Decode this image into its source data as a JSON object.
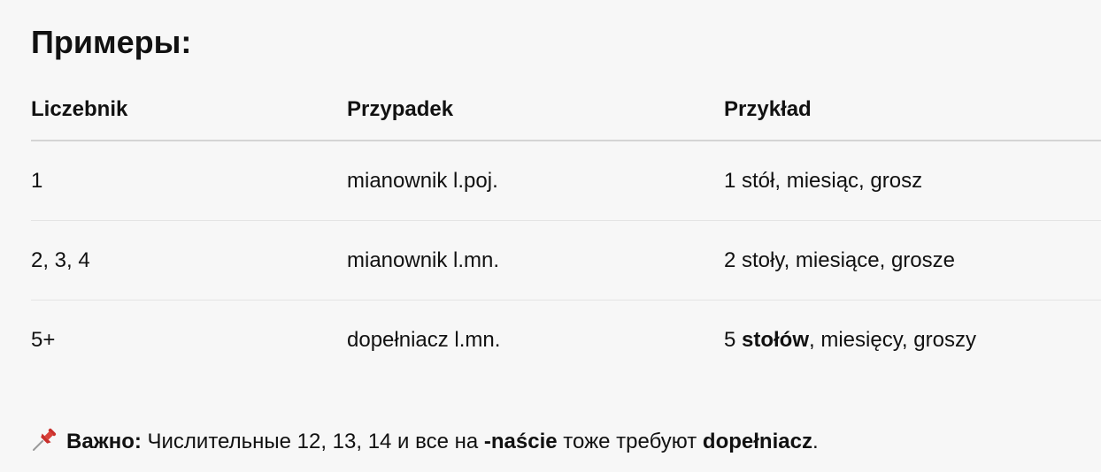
{
  "heading": "Примеры:",
  "table": {
    "headers": [
      "Liczebnik",
      "Przypadek",
      "Przykład"
    ],
    "rows": [
      {
        "num": "1",
        "case": "mianownik l.poj.",
        "example_pre": "1 stół, miesiąc, grosz",
        "example_bold": "",
        "example_post": ""
      },
      {
        "num": "2, 3, 4",
        "case": "mianownik l.mn.",
        "example_pre": "2 stoły, miesiące, grosze",
        "example_bold": "",
        "example_post": ""
      },
      {
        "num": "5+",
        "case": "dopełniacz l.mn.",
        "example_pre": "5 ",
        "example_bold": "stołów",
        "example_post": ", miesięcy, groszy"
      }
    ]
  },
  "note": {
    "icon": "pushpin-icon",
    "label": "Важно:",
    "text1": " Числительные 12, 13, 14 и все на ",
    "bold1": "-naście",
    "text2": " тоже требуют ",
    "bold2": "dopełniacz",
    "text3": "."
  }
}
